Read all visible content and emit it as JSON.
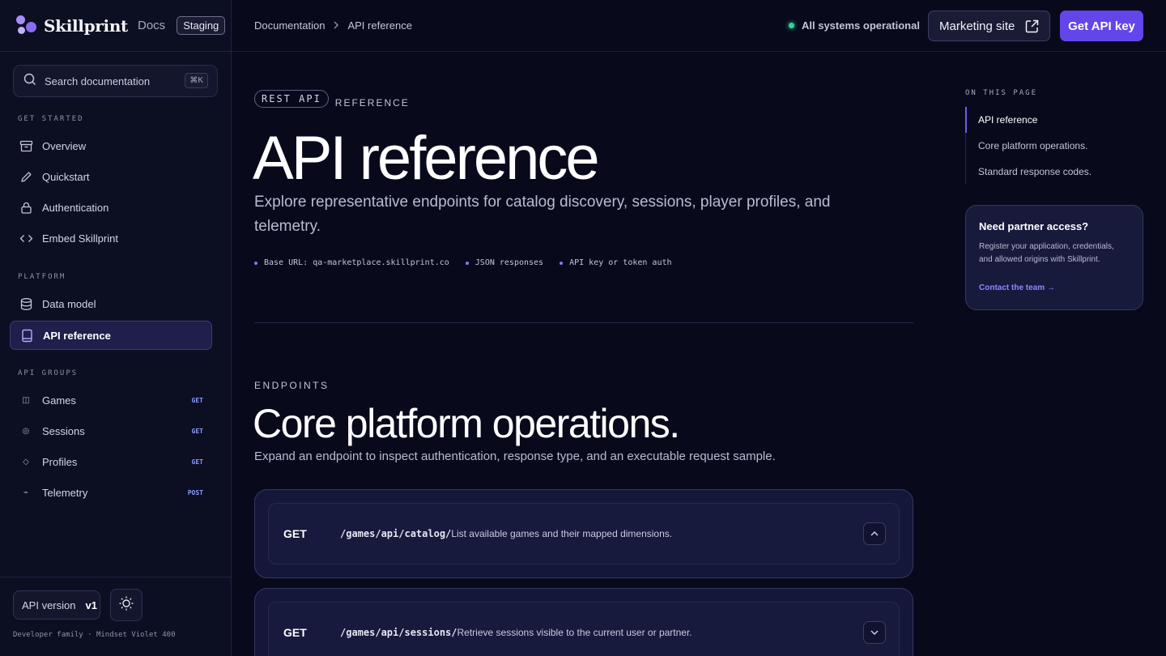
{
  "brand": {
    "name": "Skillprint",
    "docs": "Docs",
    "badge": "Staging"
  },
  "search": {
    "placeholder": "Search documentation",
    "shortcut": "⌘K"
  },
  "sidebar": {
    "get_started_label": "GET STARTED",
    "get_started": [
      {
        "label": "Overview",
        "icon": "archive-icon"
      },
      {
        "label": "Quickstart",
        "icon": "pencil-icon"
      },
      {
        "label": "Authentication",
        "icon": "lock-icon"
      },
      {
        "label": "Embed Skillprint",
        "icon": "code-icon"
      }
    ],
    "platform_label": "PLATFORM",
    "platform": [
      {
        "label": "Data model",
        "icon": "database-icon"
      },
      {
        "label": "API reference",
        "icon": "book-icon",
        "active": true
      }
    ],
    "api_groups_label": "API GROUPS",
    "api_groups": [
      {
        "label": "Games",
        "glyph": "◫",
        "method": "GET"
      },
      {
        "label": "Sessions",
        "glyph": "◎",
        "method": "GET"
      },
      {
        "label": "Profiles",
        "glyph": "◇",
        "method": "GET"
      },
      {
        "label": "Telemetry",
        "glyph": "⌁",
        "method": "POST"
      }
    ],
    "version_label": "API version",
    "version_value": "v1",
    "footer_note": "Developer family · Mindset Violet 400"
  },
  "header": {
    "breadcrumb": [
      "Documentation",
      "API reference"
    ],
    "status": "All systems operational",
    "marketing_label": "Marketing site",
    "cta_label": "Get API key"
  },
  "main": {
    "pill": "REST API",
    "eyebrow": "REFERENCE",
    "title": "API reference",
    "lead": "Explore representative endpoints for catalog discovery, sessions, player profiles, and telemetry.",
    "meta": [
      "Base URL: qa-marketplace.skillprint.co",
      "JSON responses",
      "API key or token auth"
    ],
    "endpoints_eyebrow": "ENDPOINTS",
    "endpoints_title": "Core platform operations.",
    "endpoints_sub": "Expand an endpoint to inspect authentication, response type, and an executable request sample.",
    "endpoints": [
      {
        "method": "GET",
        "path": "/games/api/catalog/",
        "desc": "List available games and their mapped dimensions.",
        "expanded": true
      },
      {
        "method": "GET",
        "path": "/games/api/sessions/",
        "desc": "Retrieve sessions visible to the current user or partner.",
        "expanded": false
      }
    ]
  },
  "toc": {
    "label": "ON THIS PAGE",
    "items": [
      "API reference",
      "Core platform operations.",
      "Standard response codes."
    ]
  },
  "partner": {
    "title": "Need partner access?",
    "body": "Register your application, credentials, and allowed origins with Skillprint.",
    "link": "Contact the team →"
  },
  "colors": {
    "accent": "#6246ea",
    "status": "#34d399",
    "bg": "#080a1c"
  }
}
